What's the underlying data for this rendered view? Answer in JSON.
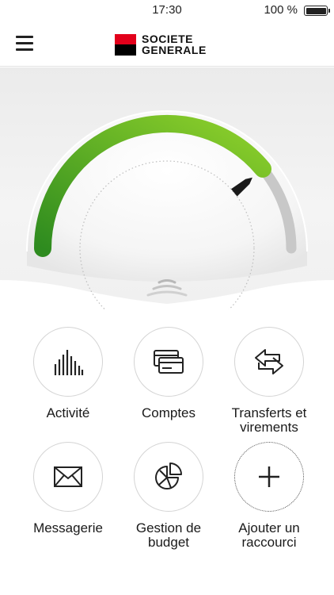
{
  "status_bar": {
    "time": "17:30",
    "battery": "100 %"
  },
  "header": {
    "menu_icon": "hamburger-icon",
    "logo": {
      "line1": "SOCIETE",
      "line2": "GENERALE",
      "red": "#e2001a",
      "black": "#000000"
    }
  },
  "gauge": {
    "level": 0.78,
    "colors": {
      "green_start": "#2e8b1f",
      "green_end": "#8fd12b",
      "track": "#c8c8c8",
      "needle": "#1a1a1a"
    },
    "handle_icon": "swipe-handle-icon"
  },
  "shortcuts": [
    {
      "icon": "activity-bars-icon",
      "line1": "Activité",
      "line2": ""
    },
    {
      "icon": "cards-icon",
      "line1": "Comptes",
      "line2": ""
    },
    {
      "icon": "transfer-arrows-icon",
      "line1": "Transferts et",
      "line2": "virements"
    },
    {
      "icon": "envelope-icon",
      "line1": "Messagerie",
      "line2": ""
    },
    {
      "icon": "pie-chart-icon",
      "line1": "Gestion de",
      "line2": "budget"
    },
    {
      "icon": "plus-icon",
      "line1": "Ajouter un",
      "line2": "raccourci"
    }
  ]
}
